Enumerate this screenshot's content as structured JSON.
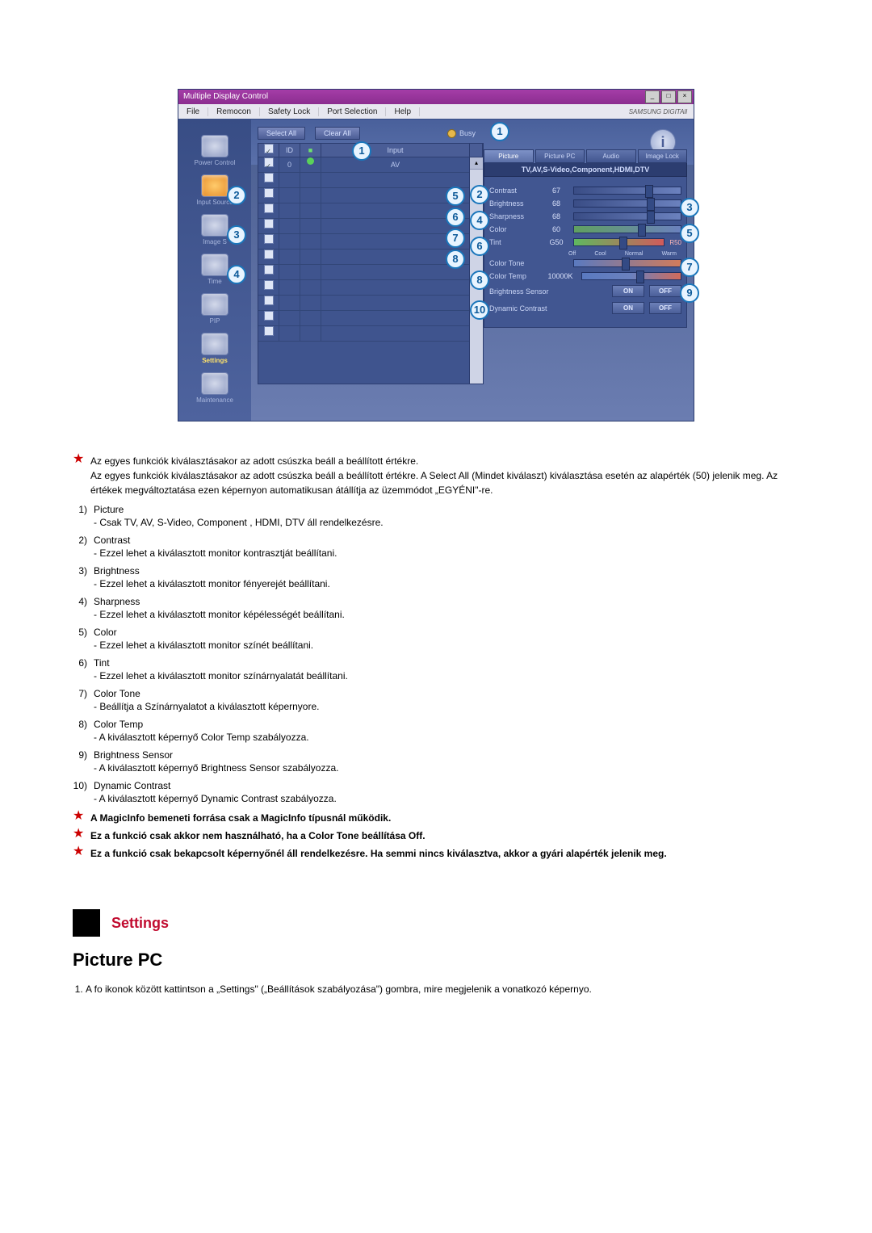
{
  "app": {
    "title": "Multiple Display Control",
    "menu": {
      "file": "File",
      "remocon": "Remocon",
      "safety": "Safety Lock",
      "port": "Port Selection",
      "help": "Help"
    },
    "brand": "SAMSUNG DIGITAll"
  },
  "sidebar": {
    "power": "Power Control",
    "input": "Input Source",
    "image": "Image S",
    "time": "Time",
    "pip": "PIP",
    "settings": "Settings",
    "maintenance": "Maintenance"
  },
  "top": {
    "selectAll": "Select All",
    "clearAll": "Clear All",
    "busy": "Busy"
  },
  "grid": {
    "h2": "ID",
    "hInput": "Input",
    "row0_id": "0",
    "row0_input": "AV"
  },
  "tabs": {
    "picture": "Picture",
    "picturePc": "Picture PC",
    "audio": "Audio",
    "imageLock": "Image Lock"
  },
  "subhead": "TV,AV,S-Video,Component,HDMI,DTV",
  "sliders": {
    "contrast": {
      "label": "Contrast",
      "value": "67"
    },
    "brightness": {
      "label": "Brightness",
      "value": "68"
    },
    "sharpness": {
      "label": "Sharpness",
      "value": "68"
    },
    "color": {
      "label": "Color",
      "value": "60"
    },
    "tint": {
      "label": "Tint",
      "left": "G50",
      "right": "R50"
    },
    "colorTone": {
      "label": "Color Tone",
      "off": "Off",
      "cool": "Cool",
      "normal": "Normal",
      "warm": "Warm"
    },
    "colorTemp": {
      "label": "Color Temp",
      "value": "10000K"
    },
    "brightSensor": {
      "label": "Brightness Sensor",
      "on": "ON",
      "off": "OFF"
    },
    "dynContrast": {
      "label": "Dynamic Contrast",
      "on": "ON",
      "off": "OFF"
    }
  },
  "info_i": "i",
  "starText": {
    "a": "Az egyes funkciók kiválasztásakor az adott csúszka beáll a beállított értékre.",
    "b": "Az egyes funkciók kiválasztásakor az adott csúszka beáll a beállított értékre. A Select All (Mindet kiválaszt) kiválasztása esetén az alapérték (50) jelenik meg. Az értékek megváltoztatása ezen képernyon automatikusan átállítja az üzemmódot „EGYÉNI\"-re."
  },
  "items": {
    "1": {
      "n": "1)",
      "t": "Picture",
      "d": "- Csak TV, AV, S-Video, Component , HDMI, DTV áll rendelkezésre."
    },
    "2": {
      "n": "2)",
      "t": "Contrast",
      "d": "- Ezzel lehet a kiválasztott monitor kontrasztját beállítani."
    },
    "3": {
      "n": "3)",
      "t": "Brightness",
      "d": "- Ezzel lehet a kiválasztott monitor fényerejét beállítani."
    },
    "4": {
      "n": "4)",
      "t": "Sharpness",
      "d": "- Ezzel lehet a kiválasztott monitor képélességét beállítani."
    },
    "5": {
      "n": "5)",
      "t": "Color",
      "d": "- Ezzel lehet a kiválasztott monitor színét beállítani."
    },
    "6": {
      "n": "6)",
      "t": "Tint",
      "d": "- Ezzel lehet a kiválasztott monitor színárnyalatát beállítani."
    },
    "7": {
      "n": "7)",
      "t": "Color Tone",
      "d": "- Beállítja a Színárnyalatot a kiválasztott képernyore."
    },
    "8": {
      "n": "8)",
      "t": "Color Temp",
      "d": "- A kiválasztott képernyő Color Temp szabályozza."
    },
    "9": {
      "n": "9)",
      "t": "Brightness Sensor",
      "d": "- A kiválasztott képernyő Brightness Sensor szabályozza."
    },
    "10": {
      "n": "10)",
      "t": "Dynamic Contrast",
      "d": "- A kiválasztott képernyő Dynamic Contrast szabályozza."
    }
  },
  "notes": {
    "n1": "A MagicInfo bemeneti forrása csak a MagicInfo típusnál működik.",
    "n2": "Ez a funkció csak akkor nem használható, ha a Color Tone beállítása Off.",
    "n3": "Ez a funkció csak bekapcsolt képernyőnél áll rendelkezésre. Ha semmi nincs kiválasztva, akkor a gyári alapérték jelenik meg."
  },
  "section": {
    "title": "Settings"
  },
  "doc": {
    "title": "Picture PC"
  },
  "step": {
    "s1": "A fo ikonok között kattintson a „Settings\" („Beállítások szabályozása\") gombra, mire megjelenik a vonatkozó képernyo."
  }
}
